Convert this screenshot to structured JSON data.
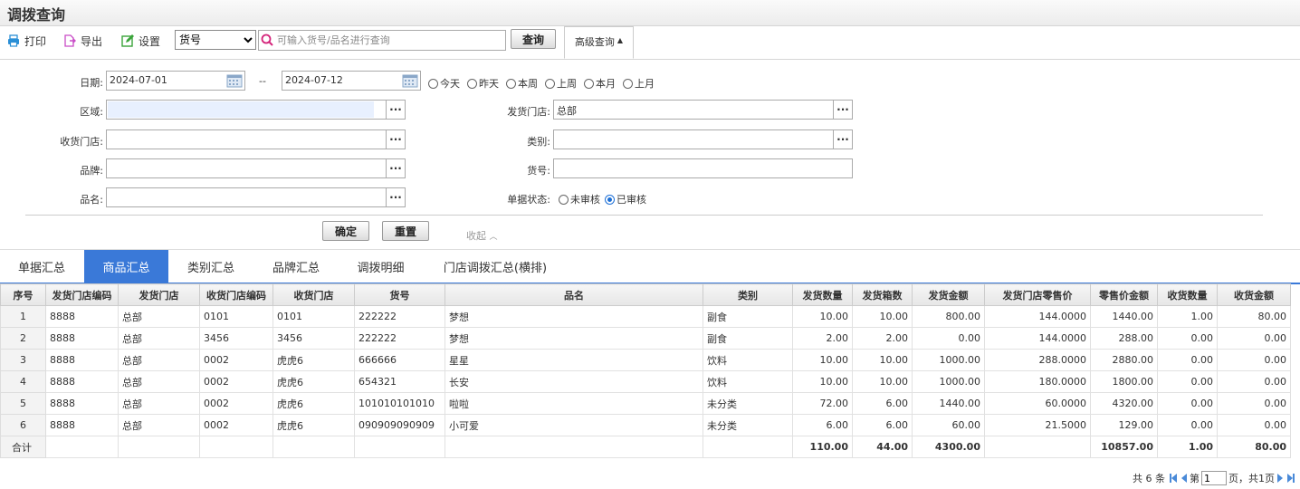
{
  "title": "调拨查询",
  "toolbar": {
    "print": "打印",
    "export": "导出",
    "settings": "设置",
    "field_select": "货号",
    "search_placeholder": "可输入货号/品名进行查询",
    "query": "查询",
    "advanced": "高级查询"
  },
  "filters": {
    "date_label": "日期:",
    "date_from": "2024-07-01",
    "date_sep": "--",
    "date_to": "2024-07-12",
    "quick": [
      "今天",
      "昨天",
      "本周",
      "上周",
      "本月",
      "上月"
    ],
    "region_label": "区域:",
    "region_value": "",
    "ship_store_label": "发货门店:",
    "ship_store_value": "总部",
    "recv_store_label": "收货门店:",
    "recv_store_value": "",
    "category_label": "类别:",
    "category_value": "",
    "brand_label": "品牌:",
    "brand_value": "",
    "sku_label": "货号:",
    "sku_value": "",
    "name_label": "品名:",
    "name_value": "",
    "status_label": "单据状态:",
    "status_options": [
      "未审核",
      "已审核"
    ],
    "status_selected": "已审核",
    "confirm": "确定",
    "reset": "重置",
    "collapse": "收起"
  },
  "tabs": [
    "单据汇总",
    "商品汇总",
    "类别汇总",
    "品牌汇总",
    "调拨明细",
    "门店调拨汇总(横排)"
  ],
  "active_tab": "商品汇总",
  "table": {
    "columns": [
      "序号",
      "发货门店编码",
      "发货门店",
      "收货门店编码",
      "收货门店",
      "货号",
      "品名",
      "类别",
      "发货数量",
      "发货箱数",
      "发货金额",
      "发货门店零售价",
      "零售价金额",
      "收货数量",
      "收货金额"
    ],
    "rows": [
      [
        "1",
        "8888",
        "总部",
        "0101",
        "0101",
        "222222",
        "梦想",
        "副食",
        "10.00",
        "10.00",
        "800.00",
        "144.0000",
        "1440.00",
        "1.00",
        "80.00"
      ],
      [
        "2",
        "8888",
        "总部",
        "3456",
        "3456",
        "222222",
        "梦想",
        "副食",
        "2.00",
        "2.00",
        "0.00",
        "144.0000",
        "288.00",
        "0.00",
        "0.00"
      ],
      [
        "3",
        "8888",
        "总部",
        "0002",
        "虎虎6",
        "666666",
        "星星",
        "饮料",
        "10.00",
        "10.00",
        "1000.00",
        "288.0000",
        "2880.00",
        "0.00",
        "0.00"
      ],
      [
        "4",
        "8888",
        "总部",
        "0002",
        "虎虎6",
        "654321",
        "长安",
        "饮料",
        "10.00",
        "10.00",
        "1000.00",
        "180.0000",
        "1800.00",
        "0.00",
        "0.00"
      ],
      [
        "5",
        "8888",
        "总部",
        "0002",
        "虎虎6",
        "101010101010",
        "啦啦",
        "未分类",
        "72.00",
        "6.00",
        "1440.00",
        "60.0000",
        "4320.00",
        "0.00",
        "0.00"
      ],
      [
        "6",
        "8888",
        "总部",
        "0002",
        "虎虎6",
        "090909090909",
        "小可爱",
        "未分类",
        "6.00",
        "6.00",
        "60.00",
        "21.5000",
        "129.00",
        "0.00",
        "0.00"
      ]
    ],
    "totals": [
      "合计",
      "",
      "",
      "",
      "",
      "",
      "",
      "",
      "110.00",
      "44.00",
      "4300.00",
      "",
      "10857.00",
      "1.00",
      "80.00"
    ]
  },
  "pager": {
    "total": "共 6 条",
    "page_prefix": "第",
    "page_value": "1",
    "page_suffix": "页，共1页"
  },
  "colors": {
    "accent": "#3a79d8",
    "search_icon": "#d4237a",
    "print_icon": "#2a8fd6",
    "export_icon": "#c94cc7",
    "settings_icon": "#3aa43a"
  }
}
